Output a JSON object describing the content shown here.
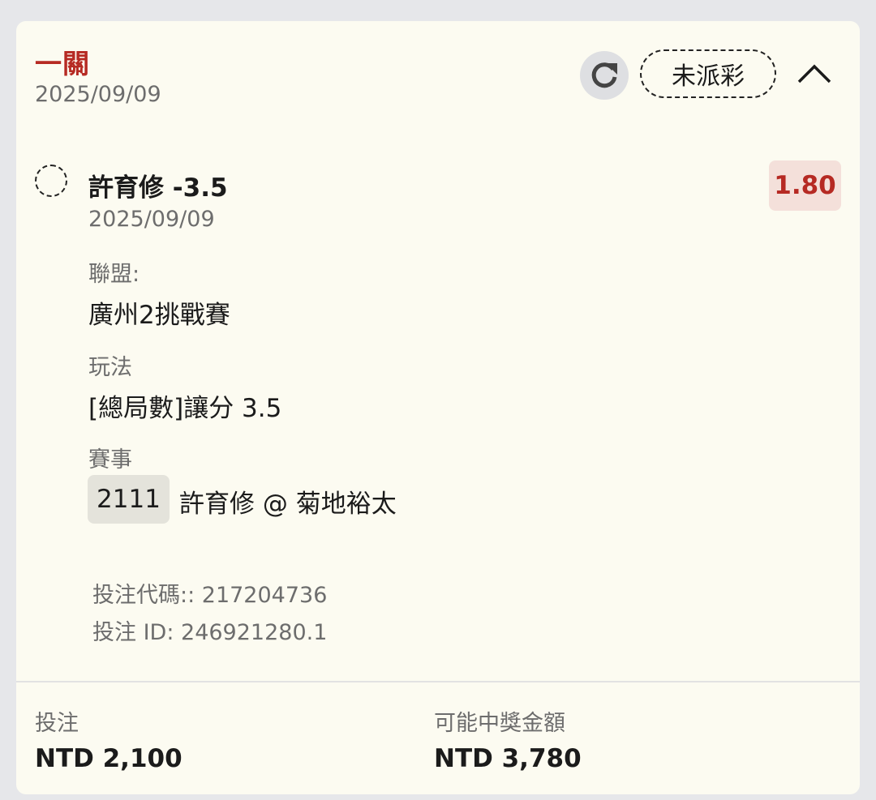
{
  "header": {
    "title": "一關",
    "date": "2025/09/09",
    "status": "未派彩",
    "icons": {
      "refresh": "refresh-icon",
      "collapse": "chevron-up-icon"
    }
  },
  "selection": {
    "name": "許育修 -3.5",
    "date": "2025/09/09",
    "odds": "1.80",
    "league_label": "聯盟:",
    "league_value": "廣州2挑戰賽",
    "market_label": "玩法",
    "market_value": "[總局數]讓分 3.5",
    "event_label": "賽事",
    "event_code": "2111",
    "event_name": "許育修 @ 菊地裕太"
  },
  "meta": {
    "bet_code": "投注代碼:: 217204736",
    "bet_id": "投注 ID: 246921280.1"
  },
  "footer": {
    "stake_label": "投注",
    "stake_value": "NTD 2,100",
    "payout_label": "可能中獎金額",
    "payout_value": "NTD 3,780"
  },
  "colors": {
    "accent": "#b62a23",
    "card_bg": "#fcfbf1",
    "page_bg": "#e6e7ea",
    "odds_bg": "#f4e0da"
  }
}
